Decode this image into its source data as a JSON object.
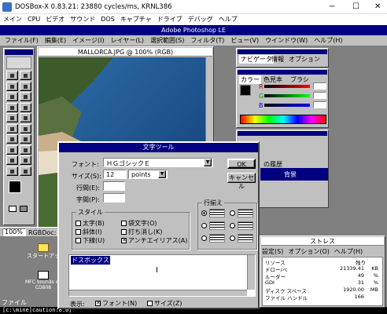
{
  "host": {
    "title": "DOSBox-X 0.83.21: 23880 cycles/ms, KRNL386",
    "menu": [
      "メイン",
      "CPU",
      "ビデオ",
      "サウンド",
      "DOS",
      "キャプチャ",
      "ドライブ",
      "デバッグ",
      "ヘルプ"
    ],
    "controls": [
      "−",
      "☐",
      "✕"
    ]
  },
  "ps": {
    "title": "Adobe Photoshop LE",
    "menu": [
      "ファイル(F)",
      "編集(E)",
      "イメージ(I)",
      "レイヤー(L)",
      "選択範囲(S)",
      "フィルタ(T)",
      "ビュー(V)",
      "ウインドウ(W)",
      "ヘルプ(H)"
    ],
    "doc_title": "MALLORCA.JPG @ 100% (RGB)",
    "zoom": "100%",
    "doc_status": "RGBDoc: 55"
  },
  "panels": {
    "tabs1": [
      "ナビゲータ",
      "情報",
      "オプション"
    ],
    "tabs2": [
      "カラー",
      "色見本",
      "ブラシ"
    ],
    "channels": [
      "R",
      "G",
      "B"
    ],
    "layer_name": "背景",
    "layer_tab": "の履歴"
  },
  "colors": {
    "r": "#d00000",
    "g": "#00a000",
    "b": "#0000d0",
    "accent": "#000080"
  },
  "desktop": {
    "icon1": "スタートアッ",
    "icon2": "MFC Sounds on\nCD808",
    "bottom": "ファイル"
  },
  "dialog": {
    "title": "文字ツール",
    "font_label": "フォント:",
    "font_value": "ＨＧゴシックＥ",
    "size_label": "サイズ(S):",
    "size_value": "12",
    "unit": "points",
    "leading_label": "行間(E):",
    "spacing_label": "字間(P):",
    "ok": "OK",
    "cancel": "キャンセル",
    "style_title": "スタイル",
    "styles": [
      {
        "label": "太字(B)",
        "checked": false
      },
      {
        "label": "斜体(I)",
        "checked": false
      },
      {
        "label": "下線(U)",
        "checked": false
      }
    ],
    "styles2": [
      {
        "label": "袋文字(O)",
        "checked": false
      },
      {
        "label": "打ち消し(K)",
        "checked": false
      },
      {
        "label": "アンチエイリアス(A)",
        "checked": true
      }
    ],
    "align_title": "行揃え",
    "text": "ドスボックス",
    "display_label": "表示:",
    "show_font": "フォント(N)",
    "show_font_checked": true,
    "show_size": "サイズ(Z)",
    "show_size_checked": false
  },
  "stress": {
    "title": "ストレス",
    "menu": [
      "設定(S)",
      "オプション(O)",
      "ヘルプ(H)"
    ],
    "header": "リソース",
    "col": "残り",
    "rows": [
      {
        "k": "ドロー/ペ",
        "v": "21339.41",
        "u": "KB"
      },
      {
        "k": "ルーダー",
        "v": "49",
        "u": "%"
      },
      {
        "k": "GDI",
        "v": "31",
        "u": "%"
      },
      {
        "k": "ディスク スペース",
        "v": "1920.00",
        "u": "MB"
      },
      {
        "k": "ファイル ハンドル",
        "v": "166",
        "u": ""
      }
    ]
  },
  "status_line": "[c:\\mine]caution:8.0]"
}
